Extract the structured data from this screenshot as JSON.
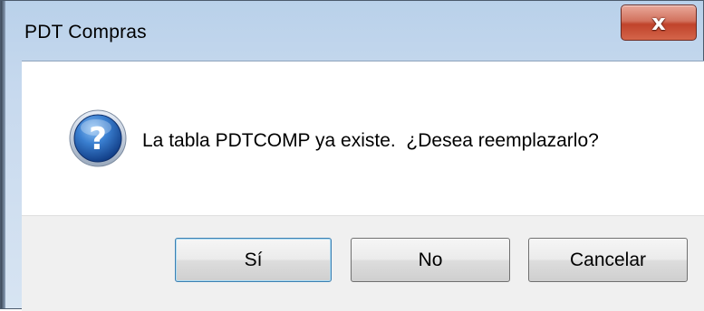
{
  "window": {
    "title": "PDT Compras",
    "close_glyph": "x"
  },
  "message": {
    "text": "La tabla PDTCOMP ya existe.  ¿Desea reemplazarlo?",
    "icon": "question-icon"
  },
  "buttons": {
    "yes_label": "Sí",
    "no_label": "No",
    "cancel_label": "Cancelar"
  },
  "colors": {
    "titlebar": "#c7d9ee",
    "close_button": "#c0432b",
    "icon_blue": "#1f5aa8",
    "button_area": "#f0f0f0"
  }
}
